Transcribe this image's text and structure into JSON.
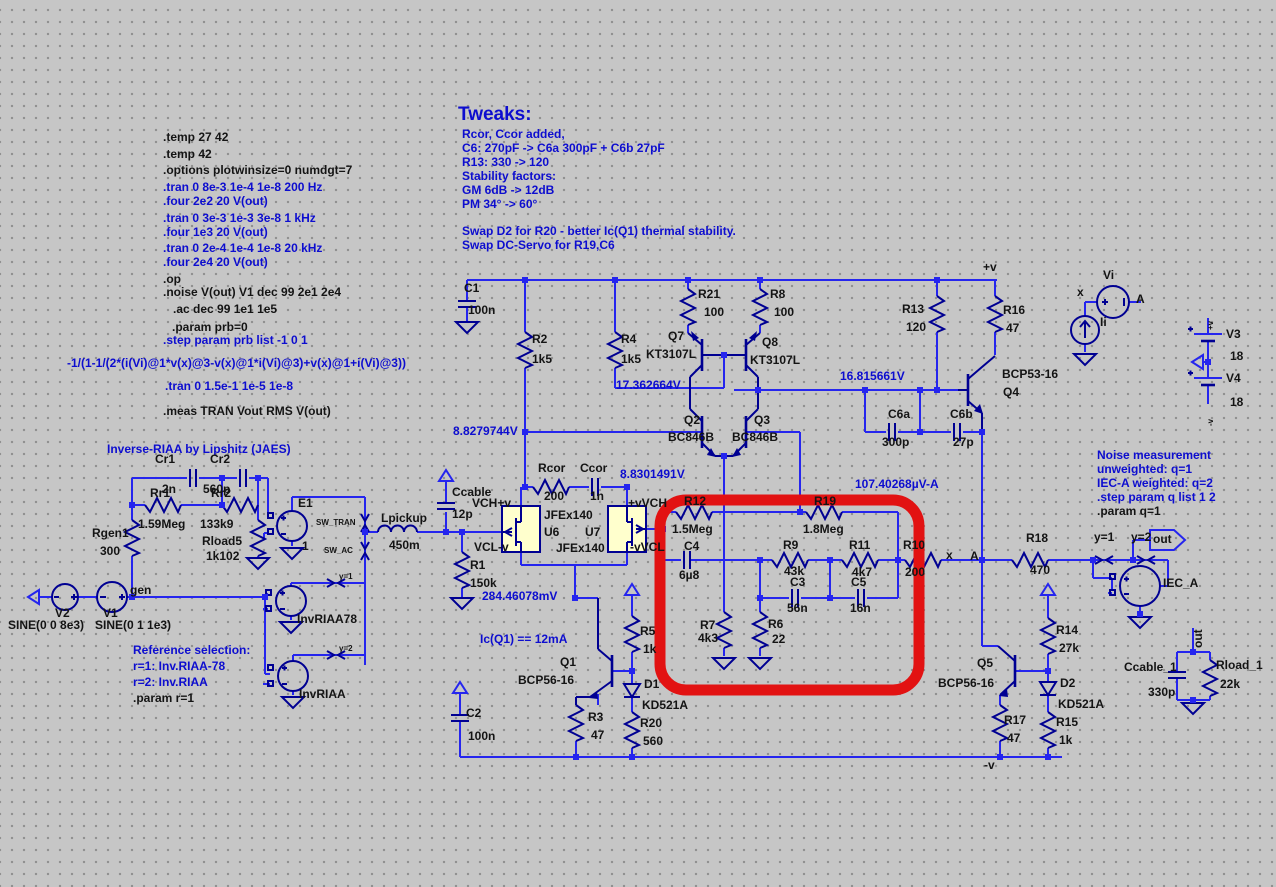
{
  "app": {
    "name": "LTspice schematic editor"
  },
  "directives": [
    {
      "text": ".temp 27 42",
      "tone": "dark"
    },
    {
      "text": ".temp 42",
      "tone": "dark"
    },
    {
      "text": ".options plotwinsize=0 numdgt=7",
      "tone": "dark"
    },
    {
      "text": ".tran 0 8e-3 1e-4 1e-8 200 Hz",
      "tone": "blue"
    },
    {
      "text": ".four 2e2 20 V(out)",
      "tone": "blue"
    },
    {
      "text": ".tran 0 3e-3 1e-3 3e-8 1 kHz",
      "tone": "blue"
    },
    {
      "text": ".four 1e3 20 V(out)",
      "tone": "blue"
    },
    {
      "text": ".tran 0 2e-4 1e-4 1e-8 20 kHz",
      "tone": "blue"
    },
    {
      "text": ".four 2e4 20 V(out)",
      "tone": "blue"
    },
    {
      "text": ".op",
      "tone": "dark"
    },
    {
      "text": ".noise V(out) V1 dec 99 2e1 2e4",
      "tone": "dark"
    },
    {
      "text": ".ac dec 99 1e1 1e5",
      "tone": "dark"
    },
    {
      "text": ".param prb=0",
      "tone": "dark"
    },
    {
      "text": ".step param prb list -1 0 1",
      "tone": "blue"
    },
    {
      "text": "-1/(1-1/(2*(i(Vi)@1*v(x)@3-v(x)@1*i(Vi)@3)+v(x)@1+i(Vi)@3))",
      "tone": "blue"
    },
    {
      "text": ".tran 0 1.5e-1 1e-5 1e-8",
      "tone": "blue"
    },
    {
      "text": ".meas TRAN Vout RMS V(out)",
      "tone": "dark"
    }
  ],
  "tweaks": {
    "title": "Tweaks:",
    "lines": [
      "Rcor, Ccor added,",
      "C6: 270pF -> C6a 300pF + C6b 27pF",
      "R13: 330 -> 120",
      "Stability factors:",
      "GM 6dB -> 12dB",
      "PM 34° -> 60°",
      "Swap D2 for R20 - better Ic(Q1) thermal stability.",
      "Swap DC-Servo for R19,C6"
    ]
  },
  "noise_note": {
    "lines": [
      "Noise measurement",
      "unweighted: q=1",
      "IEC-A weighted: q=2",
      ".step param q list 1 2",
      ".param q=1"
    ]
  },
  "riaa_note": {
    "title": "Inverse-RIAA by Lipshitz (JAES)"
  },
  "reference_note": {
    "lines": [
      "Reference selection:",
      "r=1: Inv.RIAA-78",
      "r=2: Inv.RIAA",
      ".param r=1"
    ]
  },
  "voltages": {
    "n1": "8.8279744V",
    "n2": "17.362664V",
    "n3": "16.815661V",
    "n4": "8.8301491V",
    "n5": "284.46078mV",
    "n6": "107.40268µV-A",
    "ic": "Ic(Q1) == 12mA"
  },
  "nets": {
    "plus_v": "+v",
    "minus_v": "-v",
    "vch_pv": "VCH+v",
    "vcl_mv": "VCL-v",
    "pv_vch": "+vVCH",
    "mv_vcl": "-vVCL",
    "x": "x",
    "a": "A",
    "gen": "gen",
    "out": "out",
    "y1": "y=1",
    "y2": "y=2",
    "g1": "γ=1",
    "g2": "γ=2",
    "sw_tran": "SW_TRAN",
    "sw_ac": "SW_AC"
  },
  "components": {
    "C1": {
      "ref": "C1",
      "value": "100n"
    },
    "C2": {
      "ref": "C2",
      "value": "100n"
    },
    "R2": {
      "ref": "R2",
      "value": "1k5"
    },
    "R4": {
      "ref": "R4",
      "value": "1k5"
    },
    "R21": {
      "ref": "R21",
      "value": "100"
    },
    "R8": {
      "ref": "R8",
      "value": "100"
    },
    "Q7": {
      "ref": "Q7",
      "value": "KT3107L"
    },
    "Q8": {
      "ref": "Q8",
      "value": "KT3107L"
    },
    "Q2": {
      "ref": "Q2",
      "value": "BC846B"
    },
    "Q3": {
      "ref": "Q3",
      "value": "BC846B"
    },
    "R13": {
      "ref": "R13",
      "value": "120"
    },
    "R16": {
      "ref": "R16",
      "value": "47"
    },
    "Q4": {
      "ref": "Q4",
      "value": "BCP53-16"
    },
    "C6a": {
      "ref": "C6a",
      "value": "300p"
    },
    "C6b": {
      "ref": "C6b",
      "value": "27p"
    },
    "Vi": {
      "ref": "Vi",
      "value": ""
    },
    "Ii": {
      "ref": "Ii",
      "value": ""
    },
    "V3": {
      "ref": "V3",
      "value": "18"
    },
    "V4": {
      "ref": "V4",
      "value": "18"
    },
    "Rcor": {
      "ref": "Rcor",
      "value": "200"
    },
    "Ccor": {
      "ref": "Ccor",
      "value": "1n"
    },
    "U6": {
      "ref": "U6",
      "value": "JFEx140"
    },
    "U7": {
      "ref": "U7",
      "value": "JFEx140"
    },
    "Ccable": {
      "ref": "Ccable",
      "value": "12p"
    },
    "R1": {
      "ref": "R1",
      "value": "150k"
    },
    "Lpickup": {
      "ref": "Lpickup",
      "value": "450m"
    },
    "Cr1": {
      "ref": "Cr1",
      "value": "2n"
    },
    "Cr2": {
      "ref": "Cr2",
      "value": "560p"
    },
    "Rr1": {
      "ref": "Rr1",
      "value": "1.59Meg"
    },
    "Rr2": {
      "ref": "Rr2",
      "value": "133k9"
    },
    "Rgen1": {
      "ref": "Rgen1",
      "value": "300"
    },
    "Rload5": {
      "ref": "Rload5",
      "value": "1k102"
    },
    "E1": {
      "ref": "E1",
      "value": "1"
    },
    "V2": {
      "ref": "V2",
      "value": "SINE(0 0 8e3)"
    },
    "V1": {
      "ref": "V1",
      "value": "SINE(0 1 1e3)"
    },
    "InvRIAA78": {
      "ref": "InvRIAA78",
      "value": ""
    },
    "InvRIAA": {
      "ref": "InvRIAA",
      "value": ""
    },
    "R12": {
      "ref": "R12",
      "value": "1.5Meg"
    },
    "R19": {
      "ref": "R19",
      "value": "1.8Meg"
    },
    "C4": {
      "ref": "C4",
      "value": "6µ8"
    },
    "R9": {
      "ref": "R9",
      "value": "43k"
    },
    "R11": {
      "ref": "R11",
      "value": "4k7"
    },
    "C3": {
      "ref": "C3",
      "value": "56n"
    },
    "C5": {
      "ref": "C5",
      "value": "16n"
    },
    "R7": {
      "ref": "R7",
      "value": "4k3"
    },
    "R6": {
      "ref": "R6",
      "value": "22"
    },
    "R10": {
      "ref": "R10",
      "value": "200"
    },
    "R5": {
      "ref": "R5",
      "value": "1k"
    },
    "D1": {
      "ref": "D1",
      "value": "KD521A"
    },
    "R20": {
      "ref": "R20",
      "value": "560"
    },
    "Q1": {
      "ref": "Q1",
      "value": "BCP56-16"
    },
    "R3": {
      "ref": "R3",
      "value": "47"
    },
    "R18": {
      "ref": "R18",
      "value": "470"
    },
    "IEC_A": {
      "ref": "IEC_A",
      "value": ""
    },
    "R14": {
      "ref": "R14",
      "value": "27k"
    },
    "D2": {
      "ref": "D2",
      "value": "KD521A"
    },
    "R15": {
      "ref": "R15",
      "value": "1k"
    },
    "R17": {
      "ref": "R17",
      "value": "47"
    },
    "Q5": {
      "ref": "Q5",
      "value": "BCP56-16"
    },
    "Ccable_1": {
      "ref": "Ccable_1",
      "value": "330p"
    },
    "Rload_1": {
      "ref": "Rload_1",
      "value": "22k"
    }
  },
  "highlight": {
    "color": "#e21212"
  }
}
